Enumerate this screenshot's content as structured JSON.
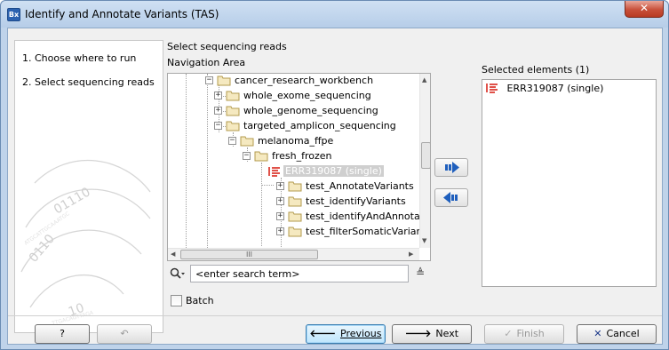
{
  "window": {
    "title": "Identify and Annotate Variants (TAS)",
    "app_icon_text": "Bx",
    "close_glyph": "✕"
  },
  "steps": [
    {
      "label": "1.  Choose where to run"
    },
    {
      "label": "2.  Select sequencing reads"
    }
  ],
  "section_title": "Select sequencing reads",
  "navigation": {
    "label": "Navigation Area",
    "tree": [
      {
        "label": "cancer_research_workbench",
        "expanded": true
      },
      {
        "label": "whole_exome_sequencing",
        "expanded": false
      },
      {
        "label": "whole_genome_sequencing",
        "expanded": false
      },
      {
        "label": "targeted_amplicon_sequencing",
        "expanded": true
      },
      {
        "label": "melanoma_ffpe",
        "expanded": true
      },
      {
        "label": "fresh_frozen",
        "expanded": true
      },
      {
        "label": "ERR319087 (single)",
        "selected": true
      },
      {
        "label": "test_AnnotateVariants",
        "expanded": false
      },
      {
        "label": "test_identifyVariants",
        "expanded": false
      },
      {
        "label": "test_identifyAndAnnota",
        "expanded": false
      },
      {
        "label": "test_filterSomaticVariar",
        "expanded": false
      }
    ],
    "hscroll_grip": "III"
  },
  "selected": {
    "label": "Selected elements (1)",
    "items": [
      {
        "label": "ERR319087 (single)"
      }
    ]
  },
  "search": {
    "placeholder": "<enter search term>",
    "value": "<enter search term>",
    "options_glyph": "≜"
  },
  "batch": {
    "label": "Batch",
    "checked": false
  },
  "buttons": {
    "help": "?",
    "reset": "↶",
    "previous": "Previous",
    "next": "Next",
    "finish": "Finish",
    "cancel": "Cancel"
  },
  "colors": {
    "accent": "#2c62b0",
    "move_arrow": "#1f5fbd",
    "reads_icon": "#d9261c",
    "cancel_x": "#1e3a8a"
  }
}
